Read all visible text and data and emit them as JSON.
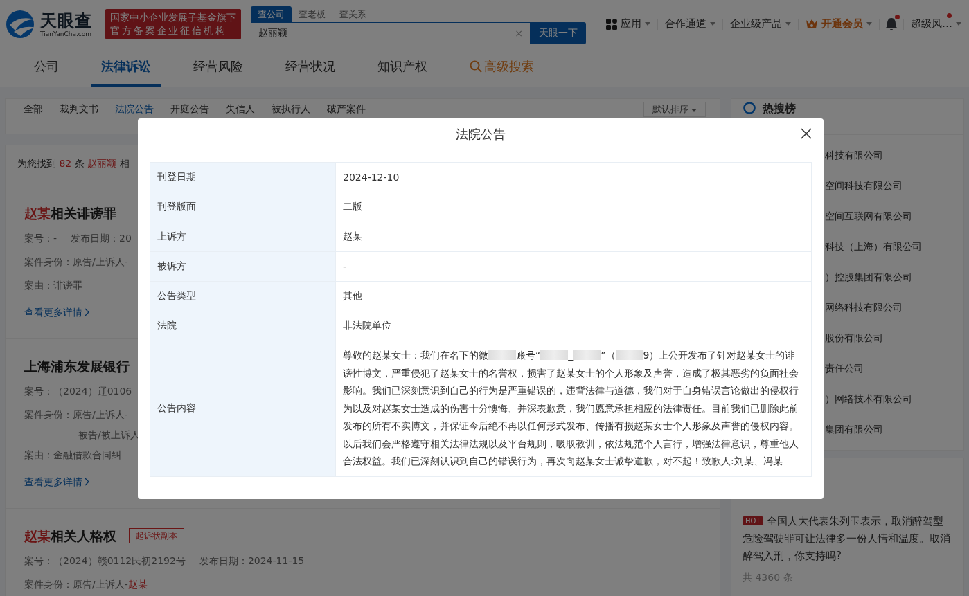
{
  "header": {
    "logo": {
      "name": "天眼查",
      "domain": "TianYanCha.com"
    },
    "badge": [
      "国家中小企业发展子基金旗下",
      "官方备案企业征信机构"
    ],
    "search_tabs": [
      {
        "label": "查公司",
        "selected": true
      },
      {
        "label": "查老板",
        "selected": false
      },
      {
        "label": "查关系",
        "selected": false
      }
    ],
    "search": {
      "value": "赵丽颖",
      "clear": "×",
      "button": "天眼一下"
    },
    "menu": [
      {
        "kind": "apps",
        "label": "应用",
        "dot": false
      },
      {
        "kind": "plain",
        "label": "合作通道",
        "dot": false
      },
      {
        "kind": "plain",
        "label": "企业级产品",
        "dot": false
      },
      {
        "kind": "vip",
        "label": "开通会员",
        "dot": false
      },
      {
        "kind": "bell",
        "dot": true
      },
      {
        "kind": "user",
        "label": "超级风…",
        "dot": true
      }
    ]
  },
  "nav": [
    {
      "kind": "plain",
      "label": "公司",
      "selected": false
    },
    {
      "kind": "plain",
      "label": "法律诉讼",
      "selected": true
    },
    {
      "kind": "plain",
      "label": "经营风险",
      "selected": false
    },
    {
      "kind": "plain",
      "label": "经营状况",
      "selected": false
    },
    {
      "kind": "plain",
      "label": "知识产权",
      "selected": false
    },
    {
      "kind": "search",
      "label": "高级搜索",
      "selected": false
    }
  ],
  "sub_tabs": [
    {
      "label": "全部",
      "selected": false
    },
    {
      "label": "裁判文书",
      "selected": false
    },
    {
      "label": "法院公告",
      "selected": true
    },
    {
      "label": "开庭公告",
      "selected": false
    },
    {
      "label": "失信人",
      "selected": false
    },
    {
      "label": "被执行人",
      "selected": false
    },
    {
      "label": "破产案件",
      "selected": false
    }
  ],
  "sort": "默认排序",
  "summary": "为您找到 **82** 条 **赵丽颖** 相",
  "cases": [
    {
      "title": "**赵某**相关诽谤罪",
      "lines": [
        {
          "items": [
            {
              "text": "案号：-",
              "indent": false
            },
            {
              "text": "发布日期：20",
              "indent": false
            }
          ]
        },
        {
          "items": [
            {
              "text": "案件身份：原告/上诉人-",
              "indent": false
            }
          ]
        },
        {
          "items": [
            {
              "text": "案由：诽谤罪",
              "indent": false
            }
          ]
        }
      ],
      "link": "查看更多详情"
    },
    {
      "title": "上海浦东发展银行",
      "lines": [
        {
          "items": [
            {
              "text": "案号：（2024）辽0106",
              "indent": false
            }
          ]
        },
        {
          "items": [
            {
              "text": "案件身份：原告/上诉人-",
              "indent": false
            }
          ]
        },
        {
          "items": [
            {
              "text": "被告/被上诉人",
              "indent": true
            }
          ]
        },
        {
          "items": [
            {
              "text": "案由：金融借款合同纠",
              "indent": false
            }
          ]
        }
      ],
      "link": "查看更多详情"
    },
    {
      "title": "**赵某**相关人格权",
      "tag": "起诉状副本",
      "lines": [
        {
          "items": [
            {
              "text": "案号：（2024）赣0112民初2192号",
              "indent": false
            },
            {
              "text": "发布日期：2024-11-15",
              "indent": false
            }
          ]
        },
        {
          "items": [
            {
              "text": "案件身份：原告/上诉人-**赵某**",
              "indent": false
            }
          ]
        }
      ]
    }
  ],
  "hot_search": {
    "title": "热搜榜",
    "items": [
      "科技有限公司",
      "空间科技有限公司",
      "空间互联网有限公司",
      "科技（上海）有限公司",
      "）控股集团有限公司",
      "网络科技有限公司",
      "股份有限公司",
      "责任公司",
      "）网络技术有限公司",
      "集团有限公司"
    ]
  },
  "news": {
    "badge": "HOT",
    "text": "全国人大代表朱列玉表示，取消醉驾型危险驾驶罪可让法律多一份人情和温度。取消醉驾入刑，你支持吗?",
    "count": "共 4360 条"
  },
  "modal": {
    "title": "法院公告",
    "rows": [
      {
        "label": "刊登日期",
        "value": "2024-12-10"
      },
      {
        "label": "刊登版面",
        "value": "二版"
      },
      {
        "label": "上诉方",
        "value": "赵某"
      },
      {
        "label": "被诉方",
        "value": "-"
      },
      {
        "label": "公告类型",
        "value": "其他"
      },
      {
        "label": "法院",
        "value": "非法院单位"
      },
      {
        "label": "公告内容",
        "segments": [
          {
            "kind": "text",
            "text": "尊敬的赵某女士：我们在名下的微"
          },
          {
            "kind": "blur"
          },
          {
            "kind": "text",
            "text": "账号“"
          },
          {
            "kind": "blur"
          },
          {
            "kind": "text",
            "text": "_"
          },
          {
            "kind": "blur"
          },
          {
            "kind": "text",
            "text": "”（"
          },
          {
            "kind": "blur"
          },
          {
            "kind": "text",
            "text": "9）上公开发布了针对赵某女士的诽谤性博文，严重侵犯了赵某女士的名誉权，损害了赵某女士的个人形象及声誉，造成了极其恶劣的负面社会影响。我们已深刻意识到自己的行为是严重错误的，违背法律与道德，我们对于自身错误言论做出的侵权行为以及对赵某女士造成的伤害十分懊悔、并深表歉意，我们愿意承担相应的法律责任。目前我们已删除此前发布的所有不实博文，并保证今后绝不再以任何形式发布、传播有损赵某女士个人形象及声誉的侵权内容。以后我们会严格遵守相关法律法规以及平台规则，吸取教训，依法规范个人言行，增强法律意识，尊重他人合法权益。我们已深刻认识到自己的错误行为，再次向赵某女士诚挚道歉，对不起！致歉人:刘某、冯某"
          }
        ]
      }
    ]
  }
}
